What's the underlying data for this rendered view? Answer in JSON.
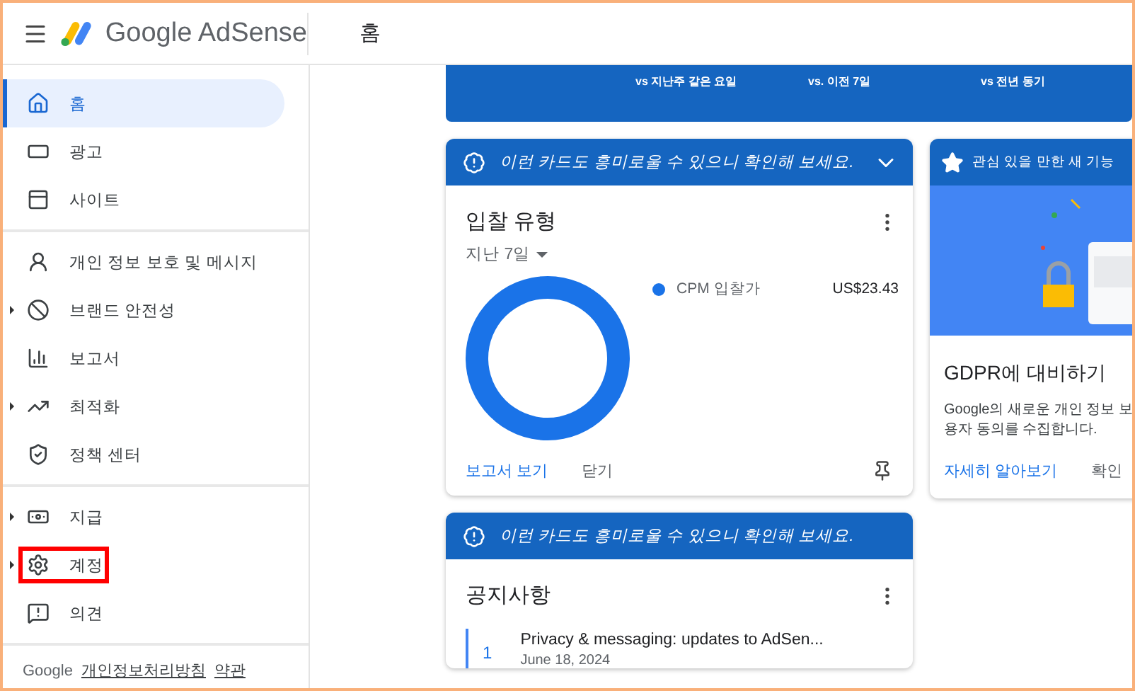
{
  "header": {
    "product": "Google AdSense",
    "page_title": "홈"
  },
  "sidebar": {
    "sections": [
      [
        {
          "label": "홈",
          "selected": true,
          "expandable": false,
          "highlighted": false
        },
        {
          "label": "광고",
          "selected": false,
          "expandable": false,
          "highlighted": false
        },
        {
          "label": "사이트",
          "selected": false,
          "expandable": false,
          "highlighted": false
        }
      ],
      [
        {
          "label": "개인 정보 보호 및 메시지",
          "selected": false,
          "expandable": false,
          "highlighted": false
        },
        {
          "label": "브랜드 안전성",
          "selected": false,
          "expandable": true,
          "highlighted": false
        },
        {
          "label": "보고서",
          "selected": false,
          "expandable": false,
          "highlighted": false
        },
        {
          "label": "최적화",
          "selected": false,
          "expandable": true,
          "highlighted": false
        },
        {
          "label": "정책 센터",
          "selected": false,
          "expandable": false,
          "highlighted": false
        }
      ],
      [
        {
          "label": "지급",
          "selected": false,
          "expandable": true,
          "highlighted": false
        },
        {
          "label": "계정",
          "selected": false,
          "expandable": true,
          "highlighted": true
        },
        {
          "label": "의견",
          "selected": false,
          "expandable": false,
          "highlighted": false
        }
      ]
    ],
    "footer": {
      "brand": "Google",
      "links": [
        "개인정보처리방침",
        "약관"
      ]
    }
  },
  "summary_banner": {
    "comparisons": [
      "vs 지난주 같은 요일",
      "vs. 이전 7일",
      "vs 전년 동기"
    ]
  },
  "bid_card": {
    "banner": "이런 카드도 흥미로울 수 있으니 확인해 보세요.",
    "title": "입찰 유형",
    "period": "지난 7일",
    "legend_values": [
      "US$23.43"
    ],
    "chart_data": {
      "type": "donut",
      "categories": [
        "CPM 입찰가"
      ],
      "series": [
        {
          "color": "#1a73e8",
          "values": [
            100
          ]
        }
      ]
    },
    "actions": [
      "보고서 보기",
      "닫기"
    ]
  },
  "notice_card": {
    "banner": "이런 카드도 흥미로울 수 있으니 확인해 보세요.",
    "title": "공지사항",
    "items": [
      {
        "number": "1",
        "title": "Privacy & messaging: updates to AdSen...",
        "date": "June 18, 2024"
      }
    ]
  },
  "feature_card": {
    "banner": "관심 있을 만한 새 기능",
    "title": "GDPR에 대비하기",
    "body": [
      "Google의 새로운 개인 정보 보",
      "용자 동의를 수집합니다."
    ],
    "actions": [
      "자세히 알아보기",
      "확인"
    ]
  }
}
